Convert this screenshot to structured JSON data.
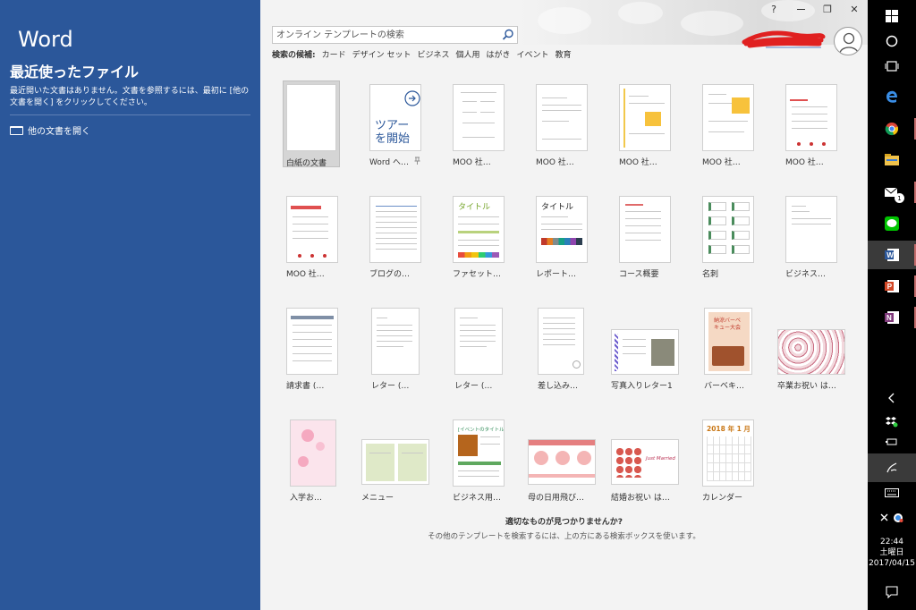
{
  "left": {
    "app_title": "Word",
    "recent_heading": "最近使ったファイル",
    "recent_desc": "最近開いた文書はありません。文書を参照するには、最初に [他の文書を開く] をクリックしてください。",
    "open_other": "他の文書を開く"
  },
  "search": {
    "placeholder": "オンライン テンプレートの検索"
  },
  "suggestions": {
    "label": "検索の候補:",
    "items": [
      "カード",
      "デザイン セット",
      "ビジネス",
      "個人用",
      "はがき",
      "イベント",
      "教育"
    ]
  },
  "window_controls": [
    "?",
    "▭",
    "❐",
    "✕"
  ],
  "templates": [
    {
      "label": "白紙の文書"
    },
    {
      "label": "Word へ…",
      "thumb_text": "ツアーを開始"
    },
    {
      "label": "MOO 社…"
    },
    {
      "label": "MOO 社…"
    },
    {
      "label": "MOO 社…"
    },
    {
      "label": "MOO 社…"
    },
    {
      "label": "MOO 社…"
    },
    {
      "label": "MOO 社…"
    },
    {
      "label": "ブログの…"
    },
    {
      "label": "ファセット…",
      "thumb_text": "タイトル"
    },
    {
      "label": "レポート…",
      "thumb_text": "タイトル"
    },
    {
      "label": "コース概要"
    },
    {
      "label": "名刺"
    },
    {
      "label": "ビジネス…"
    },
    {
      "label": "請求書 (…"
    },
    {
      "label": "レター (…"
    },
    {
      "label": "レター (…"
    },
    {
      "label": "差し込み…"
    },
    {
      "label": "写真入りレター1"
    },
    {
      "label": "バーベキ…",
      "thumb_text": "納涼バーベキュー大会"
    },
    {
      "label": "卒業お祝い は…"
    },
    {
      "label": "入学お…"
    },
    {
      "label": "メニュー"
    },
    {
      "label": "ビジネス用…",
      "thumb_text": "[イベントのタイトル]"
    },
    {
      "label": "母の日用飛び…"
    },
    {
      "label": "結婚お祝い は…",
      "thumb_text": "Just Married"
    },
    {
      "label": "カレンダー",
      "thumb_text": "2018 年 1 月"
    }
  ],
  "pin_icon": "pin-icon",
  "not_found": {
    "title": "適切なものが見つかりませんか?",
    "sub": "その他のテンプレートを検索するには、上の方にある検索ボックスを使います。"
  },
  "taskbar": {
    "clock": {
      "time": "22:44",
      "day": "土曜日",
      "date": "2017/04/15"
    },
    "mail_badge": "1"
  },
  "colors": {
    "word_blue": "#2b579a",
    "main_bg": "#f3f3f3",
    "taskbar": "#000000"
  }
}
